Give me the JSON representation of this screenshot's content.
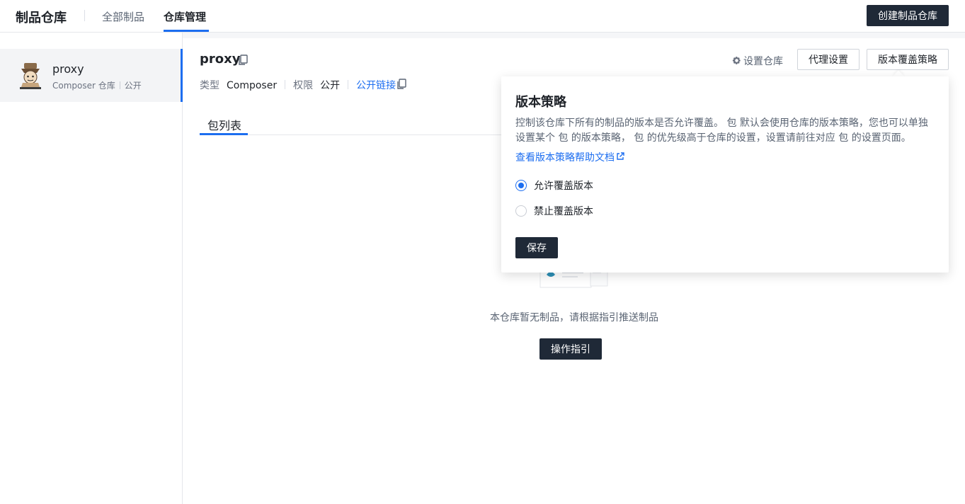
{
  "topnav": {
    "brand": "制品仓库",
    "tabs": [
      {
        "label": "全部制品"
      },
      {
        "label": "仓库管理"
      }
    ],
    "create_label": "创建制品仓库"
  },
  "sidebar": {
    "repo": {
      "name": "proxy",
      "type_label": "Composer 仓库",
      "visibility": "公开"
    }
  },
  "main": {
    "title": "proxy",
    "meta": {
      "type_label": "类型",
      "type_value": "Composer",
      "perm_label": "权限",
      "perm_value": "公开",
      "public_link": "公开链接"
    },
    "settings_label": "设置仓库",
    "proxy_label": "代理设置",
    "policy_label": "版本覆盖策略",
    "tab_label": "包列表",
    "empty_text": "本仓库暂无制品，请根据指引推送制品",
    "guide_label": "操作指引"
  },
  "popover": {
    "title": "版本策略",
    "description": "控制该仓库下所有的制品的版本是否允许覆盖。 包 默认会使用仓库的版本策略，您也可以单独设置某个 包 的版本策略， 包 的优先级高于仓库的设置，设置请前往对应 包 的设置页面。",
    "help_link": "查看版本策略帮助文档",
    "options": [
      {
        "label": "允许覆盖版本",
        "checked": true
      },
      {
        "label": "禁止覆盖版本",
        "checked": false
      }
    ],
    "save_label": "保存"
  },
  "colors": {
    "accent": "#1d6ef0",
    "dark_button": "#1f2937"
  }
}
